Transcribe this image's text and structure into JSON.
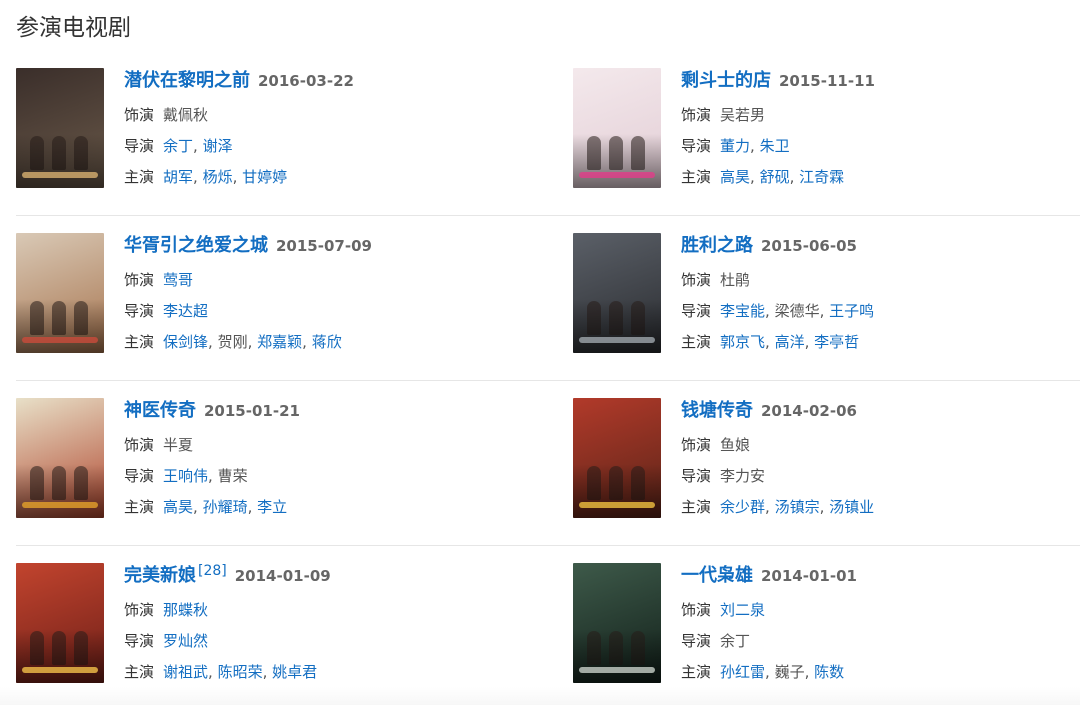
{
  "section_title": "参演电视剧",
  "labels": {
    "role": "饰演",
    "director": "导演",
    "star": "主演"
  },
  "items": [
    {
      "title": "潜伏在黎明之前",
      "sup": "",
      "date": "2016-03-22",
      "role": [
        {
          "text": "戴佩秋",
          "link": false
        }
      ],
      "director": [
        {
          "text": "余丁",
          "link": true
        },
        {
          "text": "谢泽",
          "link": true
        }
      ],
      "star": [
        {
          "text": "胡军",
          "link": true
        },
        {
          "text": "杨烁",
          "link": true
        },
        {
          "text": "甘婷婷",
          "link": true
        }
      ],
      "poster": {
        "bg1": "#3a2e2a",
        "bg2": "#6b5a4a",
        "accent": "#d8b070"
      }
    },
    {
      "title": "剩斗士的店",
      "sup": "",
      "date": "2015-11-11",
      "role": [
        {
          "text": "吴若男",
          "link": false
        }
      ],
      "director": [
        {
          "text": "董力",
          "link": true
        },
        {
          "text": "朱卫",
          "link": true
        }
      ],
      "star": [
        {
          "text": "高昊",
          "link": true
        },
        {
          "text": "舒砚",
          "link": true
        },
        {
          "text": "江奇霖",
          "link": true
        }
      ],
      "poster": {
        "bg1": "#f4e9ec",
        "bg2": "#e2cdd5",
        "accent": "#e23c8a"
      }
    },
    {
      "title": "华胥引之绝爱之城",
      "sup": "",
      "date": "2015-07-09",
      "role": [
        {
          "text": "莺哥",
          "link": true
        }
      ],
      "director": [
        {
          "text": "李达超",
          "link": true
        }
      ],
      "star": [
        {
          "text": "保剑锋",
          "link": true
        },
        {
          "text": "贺刚",
          "link": false
        },
        {
          "text": "郑嘉颖",
          "link": true
        },
        {
          "text": "蒋欣",
          "link": true
        }
      ],
      "poster": {
        "bg1": "#d9c9b6",
        "bg2": "#a7744e",
        "accent": "#c94b3b"
      }
    },
    {
      "title": "胜利之路",
      "sup": "",
      "date": "2015-06-05",
      "role": [
        {
          "text": "杜鹃",
          "link": false
        }
      ],
      "director": [
        {
          "text": "李宝能",
          "link": true
        },
        {
          "text": "梁德华",
          "link": false
        },
        {
          "text": "王子鸣",
          "link": true
        }
      ],
      "star": [
        {
          "text": "郭京飞",
          "link": true
        },
        {
          "text": "高洋",
          "link": true
        },
        {
          "text": "李亭哲",
          "link": true
        }
      ],
      "poster": {
        "bg1": "#5b6068",
        "bg2": "#2a2c30",
        "accent": "#9fa6ad"
      }
    },
    {
      "title": "神医传奇",
      "sup": "",
      "date": "2015-01-21",
      "role": [
        {
          "text": "半夏",
          "link": false
        }
      ],
      "director": [
        {
          "text": "王响伟",
          "link": true
        },
        {
          "text": "曹荣",
          "link": false
        }
      ],
      "star": [
        {
          "text": "高昊",
          "link": true
        },
        {
          "text": "孙耀琦",
          "link": true
        },
        {
          "text": "李立",
          "link": true
        }
      ],
      "poster": {
        "bg1": "#e8e0c8",
        "bg2": "#b0462e",
        "accent": "#e5a12a"
      }
    },
    {
      "title": "钱塘传奇",
      "sup": "",
      "date": "2014-02-06",
      "role": [
        {
          "text": "鱼娘",
          "link": false
        }
      ],
      "director": [
        {
          "text": "李力安",
          "link": false
        }
      ],
      "star": [
        {
          "text": "余少群",
          "link": true
        },
        {
          "text": "汤镇宗",
          "link": true
        },
        {
          "text": "汤镇业",
          "link": true
        }
      ],
      "poster": {
        "bg1": "#b23a2a",
        "bg2": "#5a2418",
        "accent": "#f0c040"
      }
    },
    {
      "title": "完美新娘",
      "sup": "[28]",
      "date": "2014-01-09",
      "role": [
        {
          "text": "那蝶秋",
          "link": true
        }
      ],
      "director": [
        {
          "text": "罗灿然",
          "link": true
        }
      ],
      "star": [
        {
          "text": "谢祖武",
          "link": true
        },
        {
          "text": "陈昭荣",
          "link": true
        },
        {
          "text": "姚卓君",
          "link": true
        }
      ],
      "poster": {
        "bg1": "#c2442e",
        "bg2": "#6e1f18",
        "accent": "#f2c14a"
      }
    },
    {
      "title": "一代枭雄",
      "sup": "",
      "date": "2014-01-01",
      "role": [
        {
          "text": "刘二泉",
          "link": true
        }
      ],
      "director": [
        {
          "text": "余丁",
          "link": false
        }
      ],
      "star": [
        {
          "text": "孙红雷",
          "link": true
        },
        {
          "text": "巍子",
          "link": false
        },
        {
          "text": "陈数",
          "link": true
        }
      ],
      "poster": {
        "bg1": "#3e5a4a",
        "bg2": "#12201a",
        "accent": "#c8d0c8"
      }
    }
  ]
}
